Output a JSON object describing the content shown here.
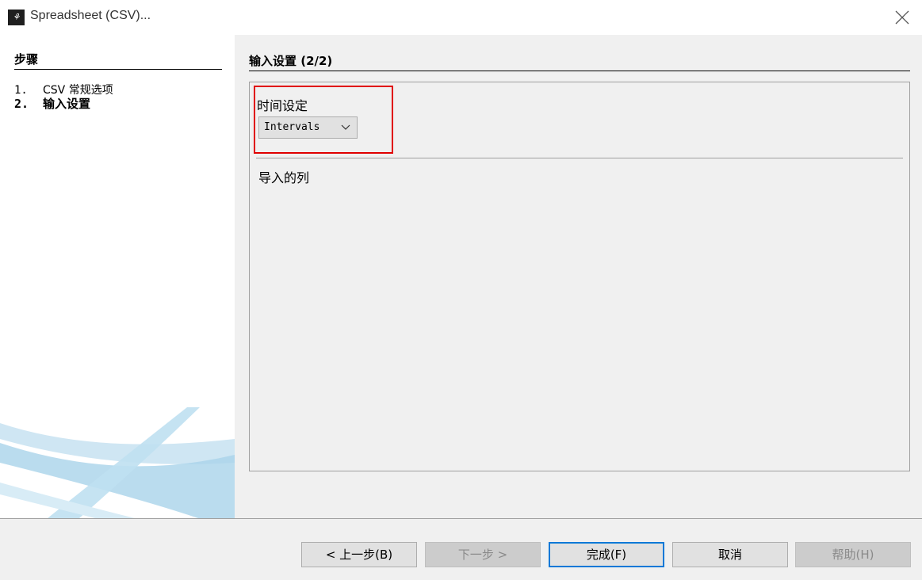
{
  "window": {
    "title": "Spreadsheet (CSV)...",
    "icon": "app-logo-icon",
    "close_icon": "close-icon"
  },
  "sidebar": {
    "header": "步骤",
    "steps": [
      {
        "num": "1.",
        "label": "CSV 常规选项",
        "active": false
      },
      {
        "num": "2.",
        "label": "输入设置",
        "active": true
      }
    ]
  },
  "main": {
    "section_title": "输入设置 (2/2)",
    "time_settings": {
      "label": "时间设定",
      "dropdown_value": "Intervals"
    },
    "imported_columns_label": "导入的列"
  },
  "footer": {
    "back": "< 上一步(B)",
    "next": "下一步 >",
    "finish": "完成(F)",
    "cancel": "取消",
    "help": "帮助(H)"
  },
  "colors": {
    "highlight": "#e00000",
    "focus": "#0078d7",
    "swoosh": "#a9d3ea"
  }
}
